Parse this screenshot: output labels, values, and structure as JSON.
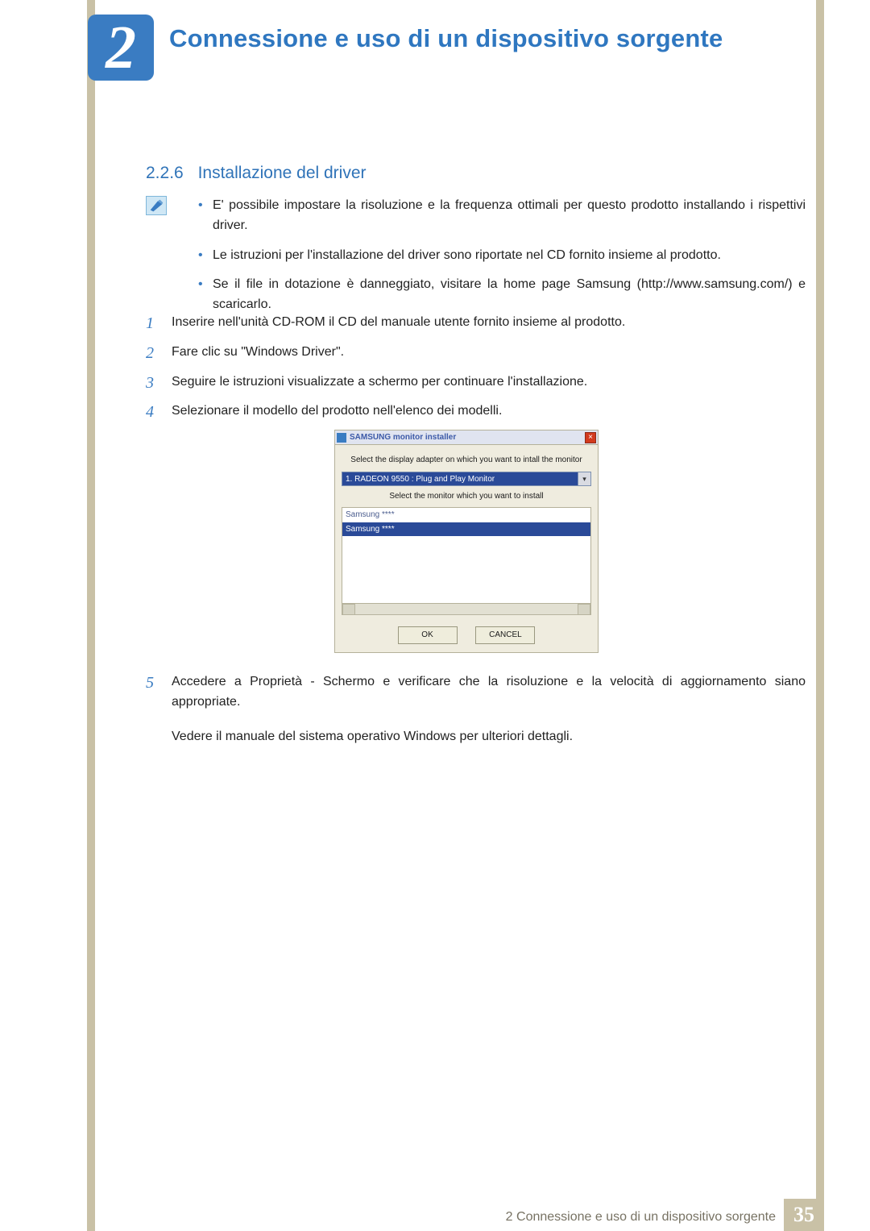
{
  "chapter": {
    "number": "2",
    "title": "Connessione e uso di un dispositivo sorgente"
  },
  "section": {
    "number": "2.2.6",
    "title": "Installazione del driver"
  },
  "notes": [
    "E' possibile impostare la risoluzione e la frequenza ottimali per questo prodotto installando i rispettivi driver.",
    "Le istruzioni per l'installazione del driver sono riportate nel CD fornito insieme al prodotto.",
    "Se il file in dotazione è danneggiato, visitare la home page Samsung (http://www.samsung.com/) e scaricarlo."
  ],
  "steps": {
    "items": [
      {
        "n": "1",
        "text": "Inserire nell'unità CD-ROM il CD del manuale utente fornito insieme al prodotto."
      },
      {
        "n": "2",
        "text": "Fare clic su \"Windows Driver\"."
      },
      {
        "n": "3",
        "text": "Seguire le istruzioni visualizzate a schermo per continuare l'installazione."
      },
      {
        "n": "4",
        "text": "Selezionare il modello del prodotto nell'elenco dei modelli."
      }
    ],
    "step5": {
      "n": "5",
      "text": "Accedere a Proprietà - Schermo e verificare che la risoluzione e la velocità di aggiornamento siano appropriate.",
      "tail": "Vedere il manuale del sistema operativo Windows per ulteriori dettagli."
    }
  },
  "installer": {
    "title": "SAMSUNG monitor installer",
    "close": "×",
    "label1": "Select the display adapter on which you want to intall the monitor",
    "dropdown_value": "1. RADEON 9550 : Plug and Play Monitor",
    "dropdown_arrow": "▾",
    "label2": "Select the monitor which you want to install",
    "list": {
      "row1": "Samsung ****",
      "row2": "Samsung ****"
    },
    "buttons": {
      "ok": "OK",
      "cancel": "CANCEL"
    }
  },
  "footer": {
    "text": "2 Connessione e uso di un dispositivo sorgente",
    "page": "35"
  }
}
